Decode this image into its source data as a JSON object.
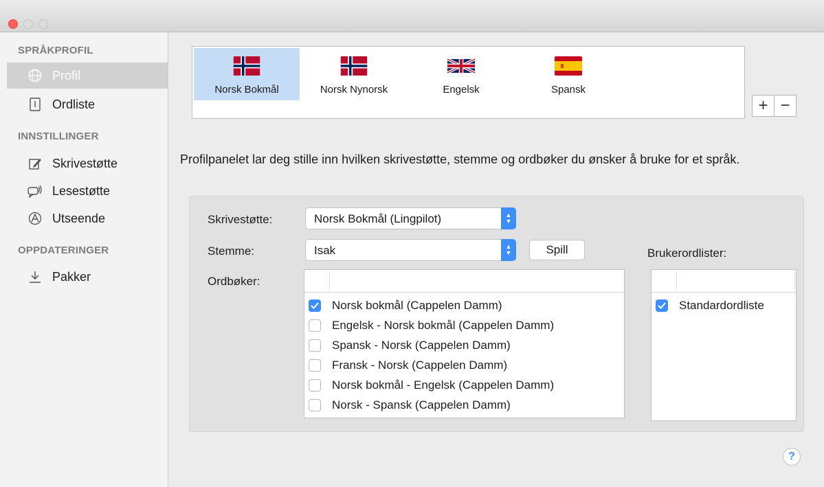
{
  "window": {
    "title": ""
  },
  "sidebar": {
    "sections": [
      {
        "header": "SPRÅKPROFIL",
        "items": [
          {
            "label": "Profil",
            "icon": "globe-icon",
            "selected": true
          },
          {
            "label": "Ordliste",
            "icon": "book-icon",
            "selected": false
          }
        ]
      },
      {
        "header": "INNSTILLINGER",
        "items": [
          {
            "label": "Skrivestøtte",
            "icon": "pencil-icon",
            "selected": false
          },
          {
            "label": "Lesestøtte",
            "icon": "speech-icon",
            "selected": false
          },
          {
            "label": "Utseende",
            "icon": "appearance-icon",
            "selected": false
          }
        ]
      },
      {
        "header": "OPPDATERINGER",
        "items": [
          {
            "label": "Pakker",
            "icon": "download-icon",
            "selected": false
          }
        ]
      }
    ]
  },
  "languages": [
    {
      "name": "Norsk Bokmål",
      "flag": "norway",
      "selected": true
    },
    {
      "name": "Norsk Nynorsk",
      "flag": "norway",
      "selected": false
    },
    {
      "name": "Engelsk",
      "flag": "uk",
      "selected": false
    },
    {
      "name": "Spansk",
      "flag": "spain",
      "selected": false
    }
  ],
  "list_controls": {
    "add": "+",
    "remove": "−"
  },
  "description": "Profilpanelet lar deg stille inn hvilken skrivestøtte, stemme og ordbøker du ønsker å bruke for et språk.",
  "form": {
    "writing_label": "Skrivestøtte:",
    "writing_value": "Norsk Bokmål (Lingpilot)",
    "voice_label": "Stemme:",
    "voice_value": "Isak",
    "play_button": "Spill",
    "dictionaries_label": "Ordbøker:",
    "user_lists_label": "Brukerordlister:"
  },
  "dictionaries": [
    {
      "label": "Norsk bokmål (Cappelen Damm)",
      "checked": true
    },
    {
      "label": "Engelsk - Norsk bokmål (Cappelen Damm)",
      "checked": false
    },
    {
      "label": "Spansk - Norsk (Cappelen Damm)",
      "checked": false
    },
    {
      "label": "Fransk - Norsk (Cappelen Damm)",
      "checked": false
    },
    {
      "label": "Norsk bokmål - Engelsk (Cappelen Damm)",
      "checked": false
    },
    {
      "label": "Norsk - Spansk (Cappelen Damm)",
      "checked": false
    }
  ],
  "user_lists": [
    {
      "label": "Standardordliste",
      "checked": true
    }
  ],
  "help": "?",
  "colors": {
    "accent": "#3e8ef7",
    "selection": "#c5dcf6",
    "sidebar_selected": "#d1d1d1"
  }
}
